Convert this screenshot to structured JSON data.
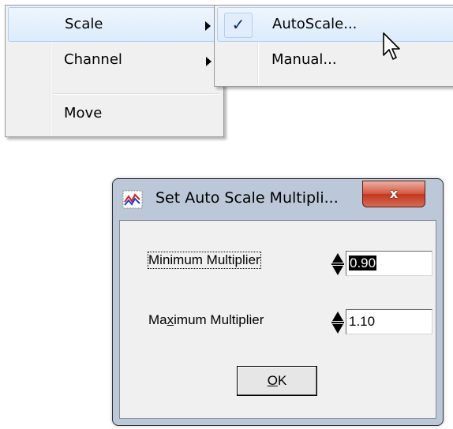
{
  "context_menu": {
    "items": [
      {
        "label": "Scale",
        "has_submenu": true,
        "highlighted": true
      },
      {
        "label": "Channel",
        "has_submenu": true,
        "highlighted": false
      },
      {
        "label": "Move",
        "has_submenu": false,
        "highlighted": false
      }
    ],
    "submenu": {
      "items": [
        {
          "label": "AutoScale...",
          "checked": true,
          "highlighted": true
        },
        {
          "label": "Manual...",
          "checked": false,
          "highlighted": false
        }
      ],
      "check_glyph": "✓"
    }
  },
  "dialog": {
    "title": "Set Auto Scale Multipli...",
    "close_glyph": "x",
    "icon": "chart-icon",
    "fields": {
      "minimum": {
        "label": "Minimum Multiplier",
        "value": "0.90"
      },
      "maximum": {
        "label_pre": "Ma",
        "label_mnemonic": "x",
        "label_post": "imum Multiplier",
        "value": "1.10"
      }
    },
    "ok_button": {
      "mnemonic": "O",
      "rest": "K"
    }
  },
  "colors": {
    "highlight_border": "#aecff7",
    "dialog_frame": "#bcc8d8",
    "close_button": "#c2371f"
  }
}
